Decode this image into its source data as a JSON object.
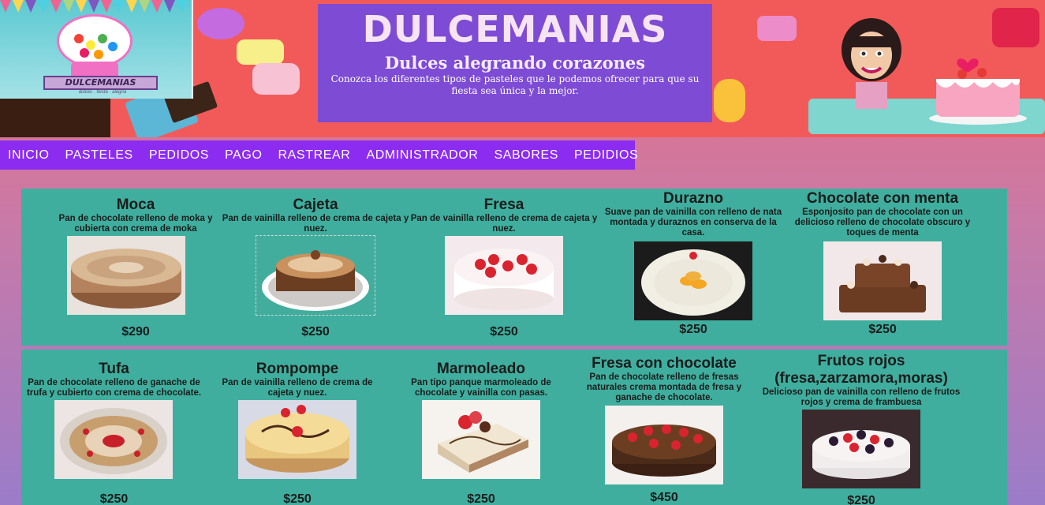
{
  "site": {
    "title": "DULCEMANIAS",
    "subtitle": "Dulces alegrando corazones",
    "description": "Conozca los diferentes tipos de pasteles que le podemos ofrecer para que su fiesta sea única y la mejor.",
    "logo_text": "DULCEMANIAS",
    "logo_sub": "dulces · fiesta · alegria"
  },
  "nav": [
    "INICIO",
    "PASTELES",
    "PEDIDOS",
    "PAGO",
    "RASTREAR",
    "ADMINISTRADOR",
    "SABORES",
    "PEDIDIOS"
  ],
  "colors": {
    "nav_bg": "#8b2cf0",
    "panel_bg": "#3fae9e",
    "title_box": "#744ade",
    "header_bg": "#f25a5a"
  },
  "cakes": [
    {
      "name": "Moca",
      "desc": "Pan de chocolate relleno de moka y cubierta con crema de moka",
      "price": "$290",
      "icon": "mocha-cake-image"
    },
    {
      "name": "Cajeta",
      "desc": "Pan de vainilla relleno de crema de cajeta y nuez.",
      "price": "$250",
      "icon": "cajeta-cake-image"
    },
    {
      "name": "Fresa",
      "desc": "Pan de vainilla relleno de crema de cajeta y nuez.",
      "price": "$250",
      "icon": "strawberry-cake-image"
    },
    {
      "name": "Durazno",
      "desc": "Suave pan de vainilla con relleno de nata montada y duraznos en conserva de la casa.",
      "price": "$250",
      "icon": "peach-cake-image"
    },
    {
      "name": "Chocolate con menta",
      "desc": "Esponjosito pan de chocolate con un delicioso relleno de chocolate obscuro y toques de menta",
      "price": "$250",
      "icon": "chocolate-mint-cake-image"
    },
    {
      "name": "Tufa",
      "desc": "Pan de chocolate relleno de ganache de trufa y cubierto con crema de chocolate.",
      "price": "$250",
      "icon": "truffle-cake-image"
    },
    {
      "name": "Rompompe",
      "desc": "Pan de vainilla relleno de crema de cajeta y nuez.",
      "price": "$250",
      "icon": "rompope-cake-image"
    },
    {
      "name": "Marmoleado",
      "desc": "Pan tipo panque marmoleado de chocolate y vainilla con pasas.",
      "price": "$250",
      "icon": "marble-cake-image"
    },
    {
      "name": "Fresa con chocolate",
      "desc": "Pan de chocolate relleno de fresas naturales crema montada de fresa y ganache de chocolate.",
      "price": "$450",
      "icon": "strawberry-chocolate-cake-image"
    },
    {
      "name": "Frutos rojos (fresa,zarzamora,moras)",
      "desc": "Delicioso pan de vainilla con relleno de frutos rojos y crema de frambuesa",
      "price": "$250",
      "icon": "berries-cake-image"
    }
  ]
}
